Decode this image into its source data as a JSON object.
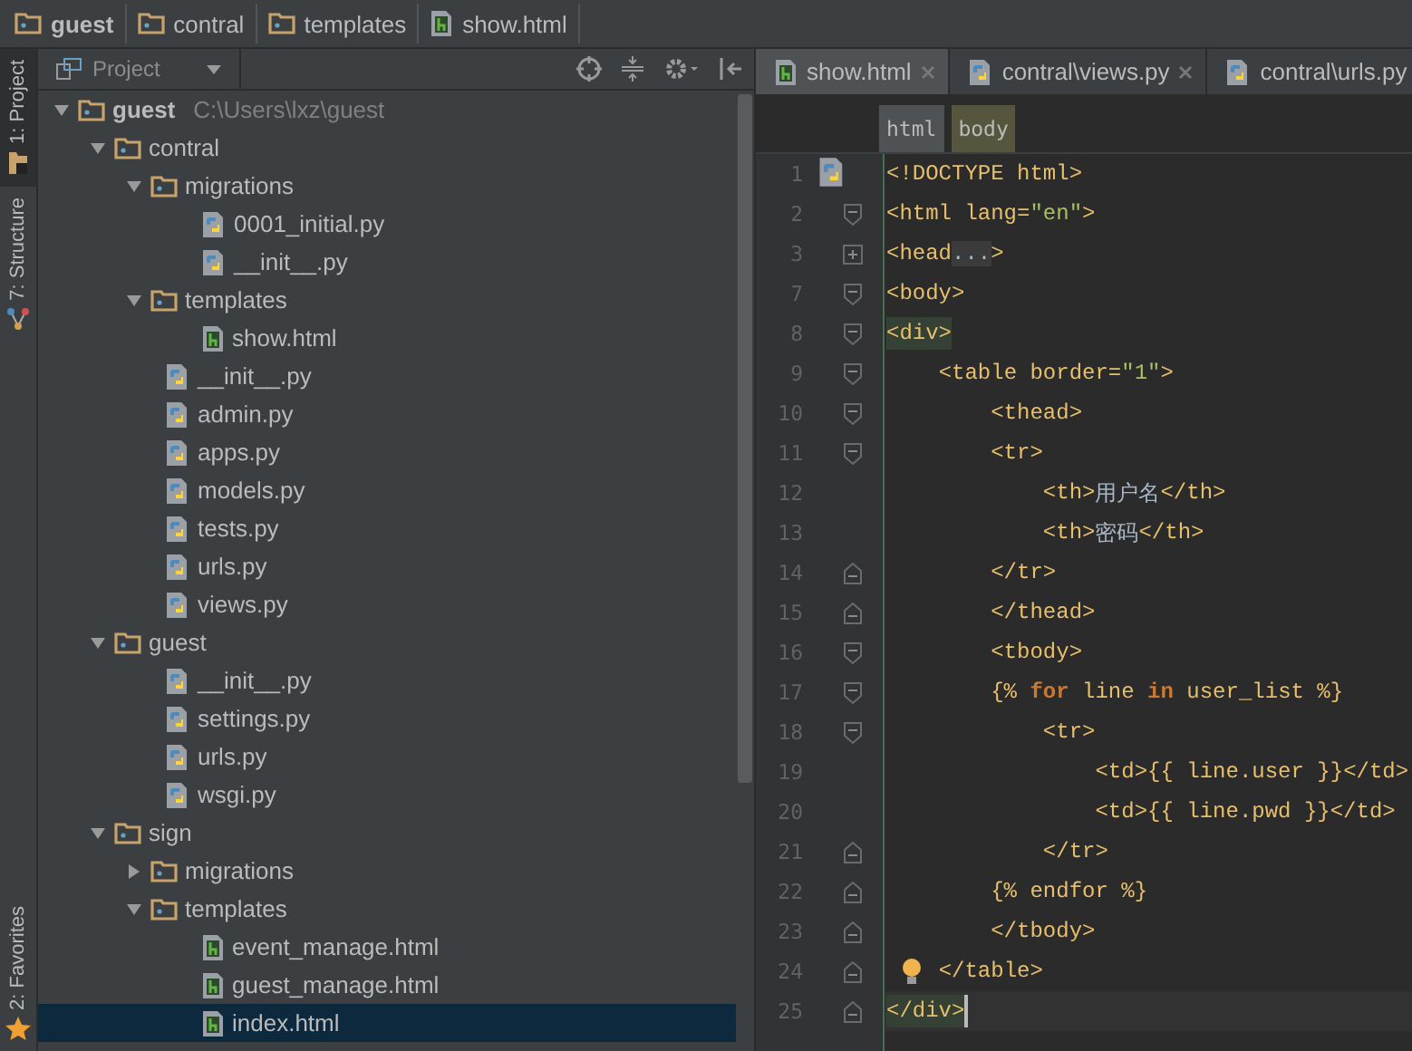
{
  "breadcrumb": [
    {
      "label": "guest",
      "kind": "root"
    },
    {
      "label": "contral",
      "kind": "folder"
    },
    {
      "label": "templates",
      "kind": "folder"
    },
    {
      "label": "show.html",
      "kind": "html"
    }
  ],
  "side_stripe": [
    {
      "label": "1: Project",
      "selected": true,
      "kind": "project"
    },
    {
      "label": "7: Structure",
      "selected": false,
      "kind": "structure"
    },
    {
      "label": "2: Favorites",
      "selected": false,
      "kind": "favorites"
    }
  ],
  "project_panel": {
    "view": "Project",
    "tree": [
      {
        "name": "guest",
        "path": "C:\\Users\\lxz\\guest",
        "kind": "root",
        "expanded": true,
        "selected": false,
        "children": [
          {
            "name": "contral",
            "kind": "folder",
            "expanded": true,
            "selected": false,
            "children": [
              {
                "name": "migrations",
                "kind": "folder",
                "expanded": true,
                "selected": false,
                "children": [
                  {
                    "name": "0001_initial.py",
                    "kind": "python",
                    "selected": false
                  },
                  {
                    "name": "__init__.py",
                    "kind": "python",
                    "selected": false
                  }
                ]
              },
              {
                "name": "templates",
                "kind": "folder",
                "expanded": true,
                "selected": false,
                "children": [
                  {
                    "name": "show.html",
                    "kind": "html",
                    "selected": false
                  }
                ]
              },
              {
                "name": "__init__.py",
                "kind": "python",
                "selected": false
              },
              {
                "name": "admin.py",
                "kind": "python",
                "selected": false
              },
              {
                "name": "apps.py",
                "kind": "python",
                "selected": false
              },
              {
                "name": "models.py",
                "kind": "python",
                "selected": false
              },
              {
                "name": "tests.py",
                "kind": "python",
                "selected": false
              },
              {
                "name": "urls.py",
                "kind": "python",
                "selected": false
              },
              {
                "name": "views.py",
                "kind": "python",
                "selected": false
              }
            ]
          },
          {
            "name": "guest",
            "kind": "folder",
            "expanded": true,
            "selected": false,
            "children": [
              {
                "name": "__init__.py",
                "kind": "python",
                "selected": false
              },
              {
                "name": "settings.py",
                "kind": "python",
                "selected": false
              },
              {
                "name": "urls.py",
                "kind": "python",
                "selected": false
              },
              {
                "name": "wsgi.py",
                "kind": "python",
                "selected": false
              }
            ]
          },
          {
            "name": "sign",
            "kind": "folder",
            "expanded": true,
            "selected": false,
            "children": [
              {
                "name": "migrations",
                "kind": "folder",
                "expanded": false,
                "selected": false
              },
              {
                "name": "templates",
                "kind": "folder",
                "expanded": true,
                "selected": false,
                "children": [
                  {
                    "name": "event_manage.html",
                    "kind": "html",
                    "selected": false
                  },
                  {
                    "name": "guest_manage.html",
                    "kind": "html",
                    "selected": false
                  },
                  {
                    "name": "index.html",
                    "kind": "html",
                    "selected": true
                  }
                ]
              }
            ]
          }
        ]
      }
    ]
  },
  "editor": {
    "tabs": [
      {
        "label": "show.html",
        "kind": "html",
        "selected": true,
        "closable": true
      },
      {
        "label": "contral\\views.py",
        "kind": "python",
        "selected": false,
        "closable": true
      },
      {
        "label": "contral\\urls.py",
        "kind": "python",
        "selected": false,
        "closable": false
      }
    ],
    "tag_path": [
      {
        "label": "html",
        "selected": false
      },
      {
        "label": "body",
        "selected": true
      }
    ],
    "lines": [
      {
        "number": "1",
        "marker": {
          "kind": "python"
        },
        "current": false,
        "segments": [
          {
            "text": "<!DOCTYPE html>",
            "kind": "tag"
          }
        ]
      },
      {
        "number": "2",
        "fold": {
          "kind": "open"
        },
        "current": false,
        "segments": [
          {
            "text": "<html lang=",
            "kind": "tag"
          },
          {
            "text": "\"en\"",
            "kind": "value"
          },
          {
            "text": ">",
            "kind": "tag"
          }
        ]
      },
      {
        "number": "3",
        "fold": {
          "kind": "collapsed"
        },
        "current": false,
        "segments": [
          {
            "text": "<head",
            "kind": "tag"
          },
          {
            "text": "...",
            "kind": "folded"
          },
          {
            "text": ">",
            "kind": "tag"
          }
        ]
      },
      {
        "number": "7",
        "fold": {
          "kind": "open"
        },
        "current": false,
        "segments": [
          {
            "text": "<body>",
            "kind": "tag"
          }
        ]
      },
      {
        "number": "8",
        "fold": {
          "kind": "open"
        },
        "current": false,
        "segments": [
          {
            "text": "<div>",
            "kind": "match"
          }
        ]
      },
      {
        "number": "9",
        "fold": {
          "kind": "open"
        },
        "current": false,
        "segments": [
          {
            "text": "    <table border=",
            "kind": "tag"
          },
          {
            "text": "\"1\"",
            "kind": "value"
          },
          {
            "text": ">",
            "kind": "tag"
          }
        ]
      },
      {
        "number": "10",
        "fold": {
          "kind": "open"
        },
        "current": false,
        "segments": [
          {
            "text": "        <thead>",
            "kind": "tag"
          }
        ]
      },
      {
        "number": "11",
        "fold": {
          "kind": "open"
        },
        "current": false,
        "segments": [
          {
            "text": "        <tr>",
            "kind": "tag"
          }
        ]
      },
      {
        "number": "12",
        "current": false,
        "segments": [
          {
            "text": "            <th>",
            "kind": "tag"
          },
          {
            "text": "用户名",
            "kind": "text"
          },
          {
            "text": "</th>",
            "kind": "tag"
          }
        ]
      },
      {
        "number": "13",
        "current": false,
        "segments": [
          {
            "text": "            <th>",
            "kind": "tag"
          },
          {
            "text": "密码",
            "kind": "text"
          },
          {
            "text": "</th>",
            "kind": "tag"
          }
        ]
      },
      {
        "number": "14",
        "fold": {
          "kind": "close"
        },
        "current": false,
        "segments": [
          {
            "text": "        </tr>",
            "kind": "tag"
          }
        ]
      },
      {
        "number": "15",
        "fold": {
          "kind": "close"
        },
        "current": false,
        "segments": [
          {
            "text": "        </thead>",
            "kind": "tag"
          }
        ]
      },
      {
        "number": "16",
        "fold": {
          "kind": "open"
        },
        "current": false,
        "segments": [
          {
            "text": "        <tbody>",
            "kind": "tag"
          }
        ]
      },
      {
        "number": "17",
        "fold": {
          "kind": "open"
        },
        "current": false,
        "segments": [
          {
            "text": "        {% ",
            "kind": "template"
          },
          {
            "text": "for",
            "kind": "keyword"
          },
          {
            "text": " line ",
            "kind": "template"
          },
          {
            "text": "in",
            "kind": "keyword"
          },
          {
            "text": " user_list %}",
            "kind": "template"
          }
        ]
      },
      {
        "number": "18",
        "fold": {
          "kind": "open"
        },
        "current": false,
        "segments": [
          {
            "text": "            <tr>",
            "kind": "tag"
          }
        ]
      },
      {
        "number": "19",
        "current": false,
        "segments": [
          {
            "text": "                <td>",
            "kind": "tag"
          },
          {
            "text": "{{ line.user }}",
            "kind": "template"
          },
          {
            "text": "</td>",
            "kind": "tag"
          }
        ]
      },
      {
        "number": "20",
        "current": false,
        "segments": [
          {
            "text": "                <td>",
            "kind": "tag"
          },
          {
            "text": "{{ line.pwd }}",
            "kind": "template"
          },
          {
            "text": "</td>",
            "kind": "tag"
          }
        ]
      },
      {
        "number": "21",
        "fold": {
          "kind": "close"
        },
        "current": false,
        "segments": [
          {
            "text": "            </tr>",
            "kind": "tag"
          }
        ]
      },
      {
        "number": "22",
        "fold": {
          "kind": "close"
        },
        "current": false,
        "segments": [
          {
            "text": "        {% endfor %}",
            "kind": "template"
          }
        ]
      },
      {
        "number": "23",
        "fold": {
          "kind": "close"
        },
        "current": false,
        "segments": [
          {
            "text": "        </tbody>",
            "kind": "tag"
          }
        ]
      },
      {
        "number": "24",
        "fold": {
          "kind": "close"
        },
        "marker": {
          "kind": "bulb"
        },
        "current": false,
        "segments": [
          {
            "text": "    </table>",
            "kind": "tag"
          }
        ]
      },
      {
        "number": "25",
        "fold": {
          "kind": "close"
        },
        "current": true,
        "segments": [
          {
            "text": "</div>",
            "kind": "match"
          }
        ]
      }
    ]
  }
}
